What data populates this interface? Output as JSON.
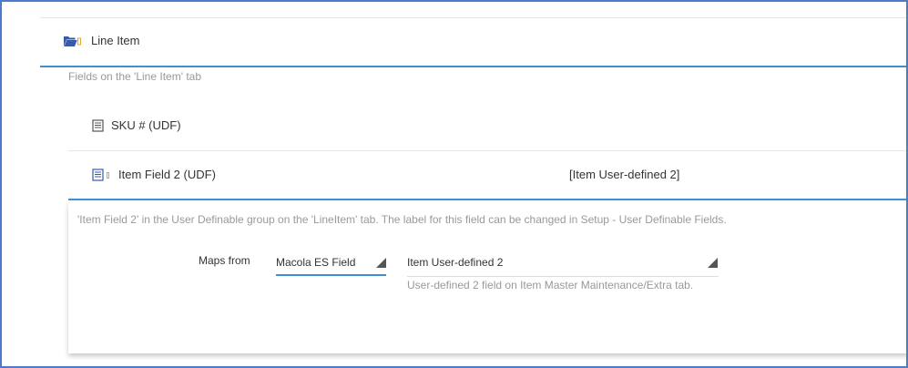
{
  "section": {
    "title": "Line Item",
    "description": "Fields on the 'Line Item' tab",
    "icon": "folder-icon"
  },
  "fields": [
    {
      "label": "SKU # (UDF)",
      "value": "",
      "icon": "list-icon"
    },
    {
      "label": "Item Field 2 (UDF)",
      "value": "[Item User-defined 2]",
      "icon": "list-icon"
    }
  ],
  "detail": {
    "description": "'Item Field 2' in the User Definable group on the 'LineItem' tab. The label for this field can be changed in Setup - User Definable Fields.",
    "maps_from_label": "Maps from",
    "source_select": {
      "value": "Macola ES Field"
    },
    "field_select": {
      "value": "Item User-defined 2"
    },
    "field_help": "User-defined 2 field on Item Master Maintenance/Extra tab."
  },
  "colors": {
    "accent": "#3f8fd6",
    "frame": "#4a7cc9",
    "icon_blue": "#3a5aa8",
    "icon_amber": "#e0a92a"
  }
}
